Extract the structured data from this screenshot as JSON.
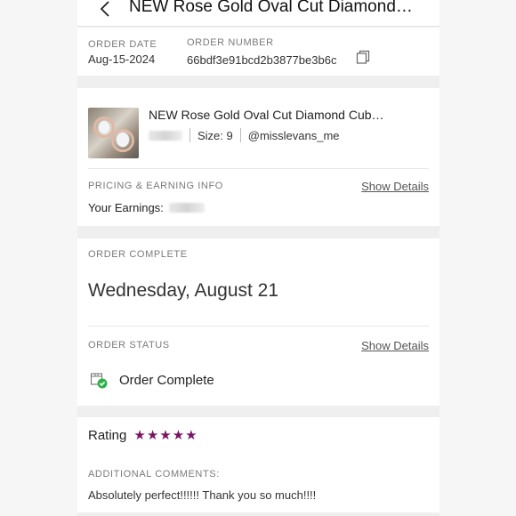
{
  "header": {
    "title": "NEW Rose Gold Oval Cut Diamond…"
  },
  "order": {
    "date_label": "ORDER DATE",
    "date_value": "Aug-15-2024",
    "number_label": "ORDER NUMBER",
    "number_value": "66bdf3e91bcd2b3877be3b6c"
  },
  "item": {
    "title": "NEW Rose Gold Oval Cut Diamond Cub…",
    "size": "Size: 9",
    "seller": "@misslevans_me"
  },
  "pricing": {
    "label": "PRICING & EARNING INFO",
    "show_details": "Show Details",
    "earnings_label": "Your Earnings:"
  },
  "completion": {
    "label": "ORDER COMPLETE",
    "date": "Wednesday, August 21",
    "status_label": "ORDER STATUS",
    "show_details": "Show Details",
    "status_text": "Order Complete"
  },
  "rating": {
    "label": "Rating",
    "stars": 5,
    "comments_label": "ADDITIONAL COMMENTS:",
    "comment": "Absolutely perfect!!!!!! Thank you so much!!!!"
  },
  "colors": {
    "star": "#7b1363",
    "status_check": "#2fb14a"
  }
}
